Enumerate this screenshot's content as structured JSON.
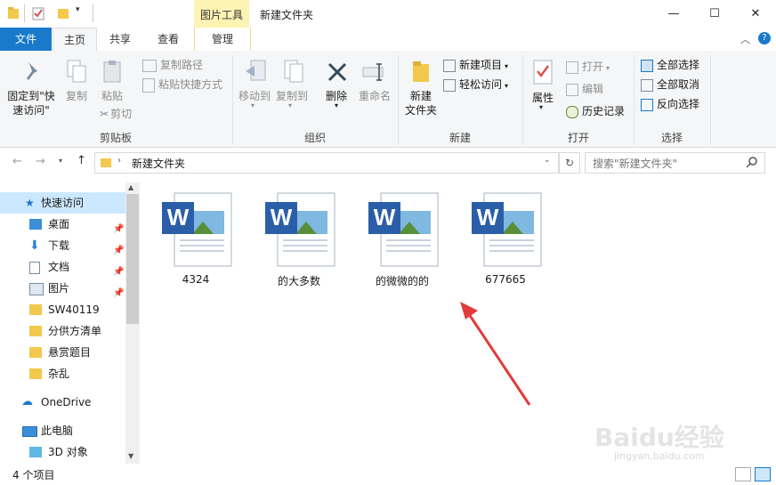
{
  "window": {
    "title": "新建文件夹",
    "context_tab": "图片工具",
    "controls": {
      "minimize": "—",
      "maximize": "☐",
      "close": "✕"
    }
  },
  "tabs": {
    "file": "文件",
    "home": "主页",
    "share": "共享",
    "view": "查看",
    "manage": "管理"
  },
  "ribbon": {
    "clipboard": {
      "pin_quick_access_line1": "固定到\"快",
      "pin_quick_access_line2": "速访问\"",
      "copy": "复制",
      "paste": "粘贴",
      "copy_path": "复制路径",
      "paste_shortcut": "粘贴快捷方式",
      "cut": "剪切",
      "label": "剪贴板"
    },
    "organize": {
      "move_to": "移动到",
      "copy_to": "复制到",
      "delete": "删除",
      "rename": "重命名",
      "label": "组织"
    },
    "new": {
      "new_folder_line1": "新建",
      "new_folder_line2": "文件夹",
      "new_item": "新建项目",
      "easy_access": "轻松访问",
      "label": "新建"
    },
    "open": {
      "properties": "属性",
      "open": "打开",
      "edit": "编辑",
      "history": "历史记录",
      "label": "打开"
    },
    "select": {
      "select_all": "全部选择",
      "select_none": "全部取消",
      "invert": "反向选择",
      "label": "选择"
    }
  },
  "address": {
    "path": "新建文件夹",
    "search_placeholder": "搜索\"新建文件夹\""
  },
  "nav": {
    "quick_access": "快速访问",
    "items": [
      {
        "label": "桌面"
      },
      {
        "label": "下载"
      },
      {
        "label": "文档"
      },
      {
        "label": "图片"
      },
      {
        "label": "SW40119"
      },
      {
        "label": "分供方清单"
      },
      {
        "label": "悬赏题目"
      },
      {
        "label": "杂乱"
      }
    ],
    "onedrive": "OneDrive",
    "this_pc": "此电脑",
    "objects_3d": "3D 对象"
  },
  "files": [
    {
      "name": "4324"
    },
    {
      "name": "的大多数"
    },
    {
      "name": "的微微的的"
    },
    {
      "name": "677665"
    }
  ],
  "status": {
    "count": "4 个项目"
  },
  "watermark": {
    "brand": "Baidu经验",
    "url": "jingyan.baidu.com"
  },
  "colors": {
    "accent": "#1979ca",
    "context_tab": "#fdf3b3",
    "selected": "#cce8ff",
    "arrow": "#e23b3b"
  }
}
